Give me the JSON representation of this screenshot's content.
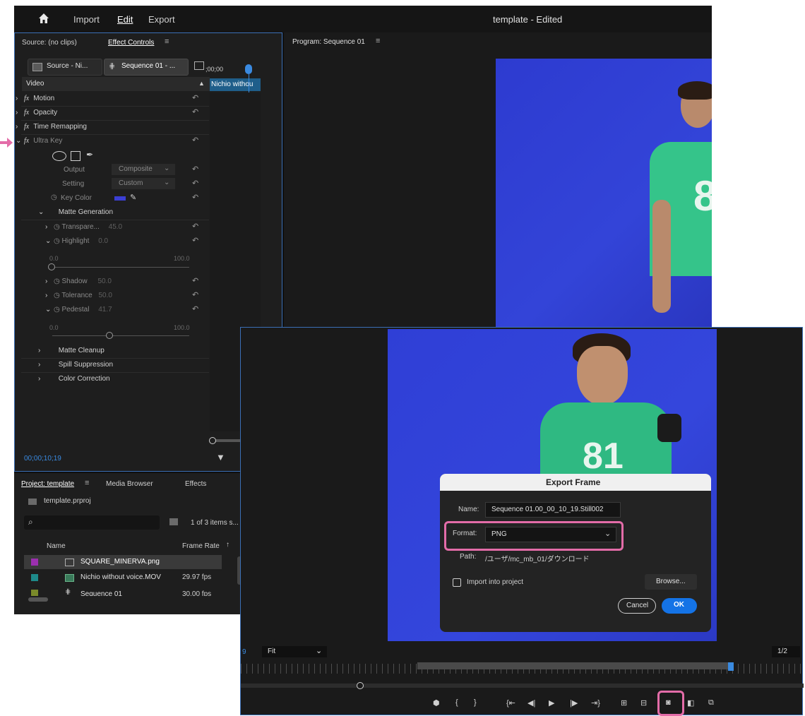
{
  "app": {
    "nav": {
      "import": "Import",
      "edit": "Edit",
      "export": "Export"
    },
    "title": "template - Edited"
  },
  "source_panel": {
    "tab_source": "Source: (no clips)",
    "tab_effect_controls": "Effect Controls",
    "clip_source": "Source - Ni...",
    "clip_sequence": "Sequence 01 - ...",
    "timeline_time": ";00;00",
    "clip_name": "Nichio withou",
    "video_header": "Video",
    "effects": {
      "motion": "Motion",
      "opacity": "Opacity",
      "time_remapping": "Time Remapping",
      "ultra_key": "Ultra Key"
    },
    "output_label": "Output",
    "output_value": "Composite",
    "setting_label": "Setting",
    "setting_value": "Custom",
    "key_color_label": "Key Color",
    "key_color": "#3b3fd4",
    "matte_generation": "Matte Generation",
    "transparency_label": "Transpare...",
    "transparency_value": "45.0",
    "highlight_label": "Highlight",
    "highlight_value": "0.0",
    "slider_min": "0.0",
    "slider_max": "100.0",
    "shadow_label": "Shadow",
    "shadow_value": "50.0",
    "tolerance_label": "Tolerance",
    "tolerance_value": "50.0",
    "pedestal_label": "Pedestal",
    "pedestal_value": "41.7",
    "slider2_min": "0.0",
    "slider2_max": "100.0",
    "matte_cleanup": "Matte Cleanup",
    "spill_suppression": "Spill Suppression",
    "color_correction": "Color Correction",
    "timecode": "00;00;10;19"
  },
  "program_panel": {
    "title": "Program: Sequence 01"
  },
  "project_panel": {
    "tab_project": "Project: template",
    "tab_media": "Media Browser",
    "tab_effects": "Effects",
    "file": "template.prproj",
    "items_count": "1 of 3 items s...",
    "col_name": "Name",
    "col_frame_rate": "Frame Rate",
    "rows": [
      {
        "name": "SQUARE_MINERVA.png",
        "rate": "",
        "color": "#9b2fae"
      },
      {
        "name": "Nichio without voice.MOV",
        "rate": "29.97 fps",
        "color": "#1e8a8a"
      },
      {
        "name": "Sequence 01",
        "rate": "30.00 fps",
        "color": "#7a8a2a"
      }
    ]
  },
  "export_dialog": {
    "title": "Export Frame",
    "name_label": "Name:",
    "name_value": "Sequence 01.00_00_10_19.Still002",
    "format_label": "Format:",
    "format_value": "PNG",
    "path_label": "Path:",
    "path_value": "/ユーザ/mc_mb_01/ダウンロード",
    "import_label": "Import into project",
    "browse": "Browse...",
    "cancel": "Cancel",
    "ok": "OK"
  },
  "monitor_controls": {
    "fit": "Fit",
    "fraction": "1/2",
    "timecode_edge": "9"
  },
  "colors": {
    "panel_bg": "#1e1e1e",
    "accent_blue": "#2e7bd6",
    "highlight_pink": "#e36ca8",
    "chroma_blue": "#2f3fd6"
  }
}
